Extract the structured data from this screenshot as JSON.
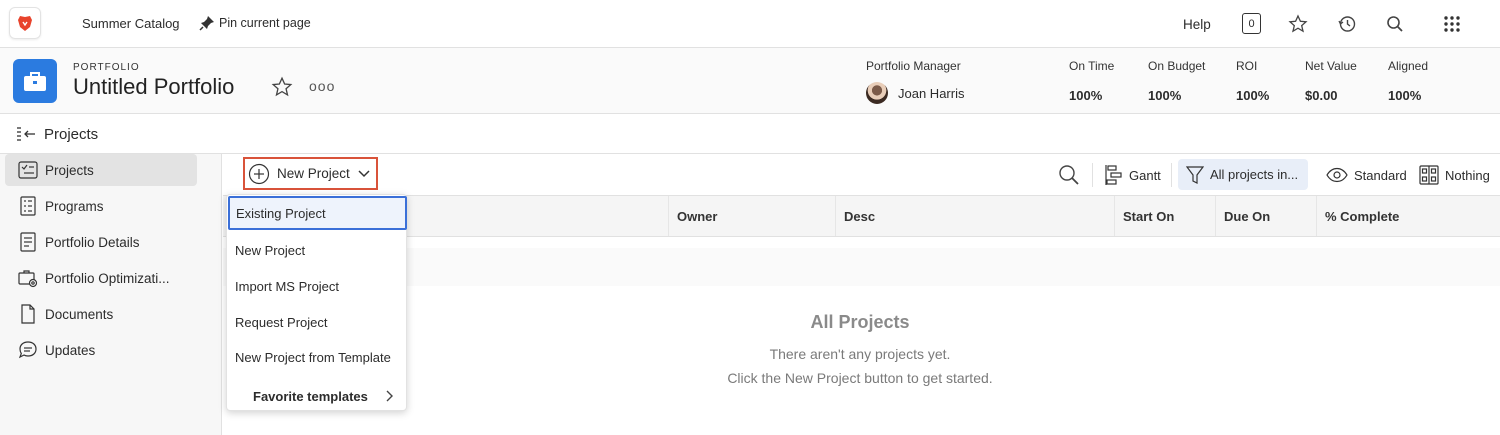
{
  "topbar": {
    "catalog": "Summer Catalog",
    "pin_label": "Pin current page",
    "help": "Help",
    "notification_count": "0"
  },
  "portfolio": {
    "label": "PORTFOLIO",
    "title": "Untitled Portfolio",
    "more": "ooo",
    "manager_label": "Portfolio Manager",
    "manager_name": "Joan Harris",
    "metrics": [
      {
        "label": "On Time",
        "value": "100%"
      },
      {
        "label": "On Budget",
        "value": "100%"
      },
      {
        "label": "ROI",
        "value": "100%"
      },
      {
        "label": "Net Value",
        "value": "$0.00"
      },
      {
        "label": "Aligned",
        "value": "100%"
      }
    ]
  },
  "subnav": {
    "title": "Projects"
  },
  "sidebar": {
    "items": [
      {
        "label": "Projects",
        "icon": "projects-icon",
        "active": true
      },
      {
        "label": "Programs",
        "icon": "programs-icon"
      },
      {
        "label": "Portfolio Details",
        "icon": "details-icon"
      },
      {
        "label": "Portfolio Optimizati...",
        "icon": "optimization-icon"
      },
      {
        "label": "Documents",
        "icon": "document-icon"
      },
      {
        "label": "Updates",
        "icon": "chat-icon"
      }
    ]
  },
  "toolbar": {
    "new_project": "New Project",
    "gantt": "Gantt",
    "filter": "All projects in...",
    "view": "Standard",
    "grouping": "Nothing"
  },
  "table": {
    "columns": [
      "Owner",
      "Desc",
      "Start On",
      "Due On",
      "% Complete"
    ]
  },
  "empty_state": {
    "title": "All Projects",
    "line1": "There aren't any projects yet.",
    "line2": "Click the New Project button to get started."
  },
  "menu": {
    "items": [
      "Existing Project",
      "New Project",
      "Import MS Project",
      "Request Project",
      "New Project from Template"
    ],
    "favorites": "Favorite templates"
  },
  "colors": {
    "accent_blue": "#2b7be0",
    "highlight_red": "#d9533a",
    "selection_blue": "#3a6fd8"
  }
}
